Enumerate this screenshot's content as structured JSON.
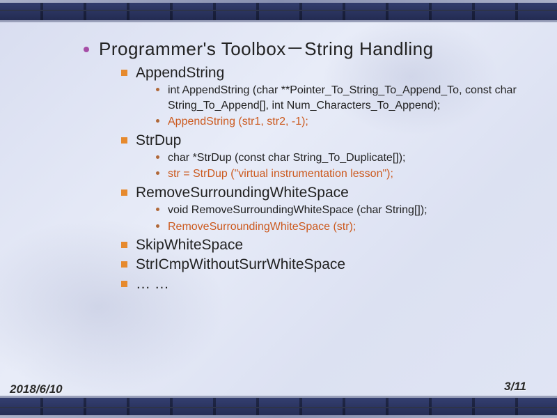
{
  "title": "Programmer's Toolbox－String Handling",
  "sections": [
    {
      "name": "AppendString",
      "details": [
        {
          "text": "int AppendString (char **Pointer_To_String_To_Append_To, const char String_To_Append[], int Num_Characters_To_Append);",
          "example": false
        },
        {
          "text": "AppendString (str1, str2, -1);",
          "example": true
        }
      ]
    },
    {
      "name": "StrDup",
      "details": [
        {
          "text": "char *StrDup (const char String_To_Duplicate[]);",
          "example": false
        },
        {
          "text": "str = StrDup (\"virtual instrumentation lesson\");",
          "example": true
        }
      ]
    },
    {
      "name": "RemoveSurroundingWhiteSpace",
      "details": [
        {
          "text": "void RemoveSurroundingWhiteSpace (char String[]);",
          "example": false
        },
        {
          "text": "RemoveSurroundingWhiteSpace (str);",
          "example": true
        }
      ]
    },
    {
      "name": "SkipWhiteSpace",
      "details": []
    },
    {
      "name": "StrICmpWithoutSurrWhiteSpace",
      "details": []
    },
    {
      "name": "… …",
      "details": []
    }
  ],
  "footer": {
    "date": "2018/6/10",
    "page": "3/11"
  },
  "colors": {
    "bullet_lvl1": "#a64da6",
    "bullet_lvl2": "#e68a2e",
    "example_text": "#cc5a1f"
  }
}
